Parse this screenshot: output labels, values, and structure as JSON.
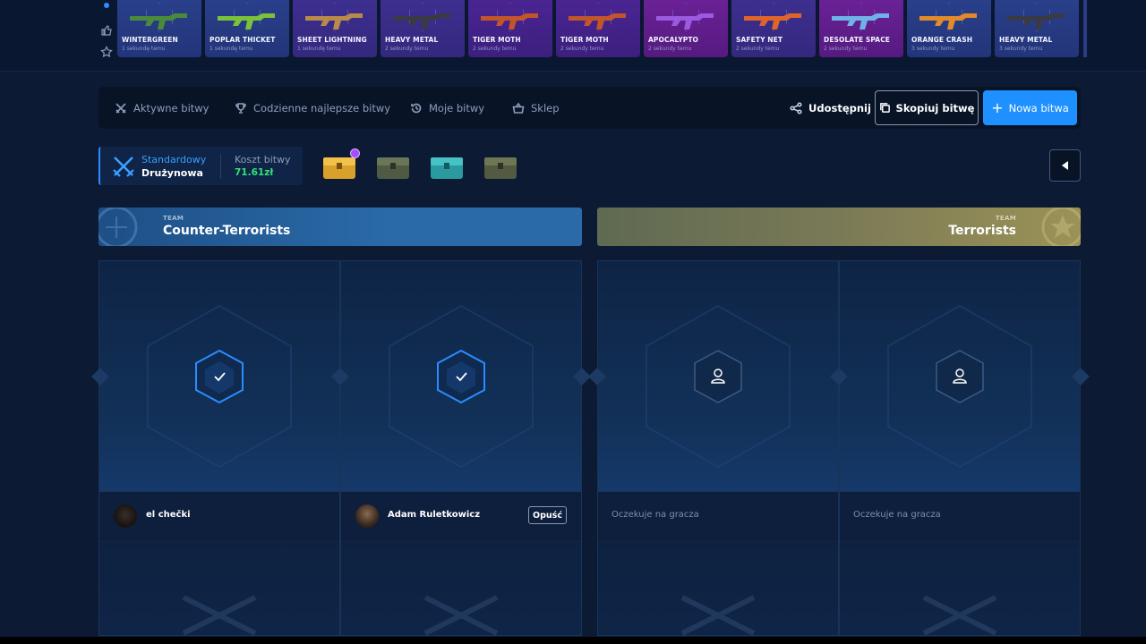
{
  "ticker": {
    "drops": [
      {
        "name": "WINTERGREEN",
        "time": "1 sekundę temu",
        "rarity": "mil",
        "color": "#4a8a3a"
      },
      {
        "name": "POPLAR THICKET",
        "time": "1 sekundę temu",
        "rarity": "mil",
        "color": "#7ac23a"
      },
      {
        "name": "SHEET LIGHTNING",
        "time": "1 sekundę temu",
        "rarity": "res",
        "color": "#b98a4a"
      },
      {
        "name": "HEAVY METAL",
        "time": "2 sekundy temu",
        "rarity": "res",
        "color": "#3a3a44"
      },
      {
        "name": "TIGER MOTH",
        "time": "2 sekundy temu",
        "rarity": "cla",
        "color": "#c2552a"
      },
      {
        "name": "TIGER MOTH",
        "time": "2 sekundy temu",
        "rarity": "cla",
        "color": "#c2552a"
      },
      {
        "name": "APOCALYPTO",
        "time": "2 sekundy temu",
        "rarity": "cov",
        "color": "#9b5adf"
      },
      {
        "name": "SAFETY NET",
        "time": "2 sekundy temu",
        "rarity": "res",
        "color": "#e0642a"
      },
      {
        "name": "DESOLATE SPACE",
        "time": "2 sekundy temu",
        "rarity": "cov",
        "color": "#6fb2e8"
      },
      {
        "name": "ORANGE CRASH",
        "time": "3 sekundy temu",
        "rarity": "mil",
        "color": "#e08a2a"
      },
      {
        "name": "HEAVY METAL",
        "time": "3 sekundy temu",
        "rarity": "mil",
        "color": "#3a3a44"
      }
    ]
  },
  "nav": {
    "active_battles": "Aktywne bitwy",
    "daily_best": "Codzienne najlepsze bitwy",
    "my_battles": "Moje bitwy",
    "shop": "Sklep",
    "share": "Udostępnij",
    "copy_battle": "Skopiuj bitwę",
    "new_battle": "Nowa bitwa"
  },
  "battle": {
    "mode_label": "Standardowy",
    "mode_value": "Drużynowa",
    "cost_label": "Koszt bitwy",
    "cost_value": "71.61zł"
  },
  "teams": {
    "ct": {
      "tag": "TEAM",
      "name": "Counter-Terrorists"
    },
    "t": {
      "tag": "TEAM",
      "name": "Terrorists"
    }
  },
  "players": {
    "slot1": {
      "name": "el chečki"
    },
    "slot2": {
      "name": "Adam Ruletkowicz",
      "leave": "Opuść"
    },
    "slot3": {
      "waiting": "Oczekuje na gracza"
    },
    "slot4": {
      "waiting": "Oczekuje na gracza"
    }
  },
  "colors": {
    "accent": "#1e90ff",
    "cost": "#35e07a",
    "ct": "#2a6aa8",
    "t": "#9b9256"
  }
}
